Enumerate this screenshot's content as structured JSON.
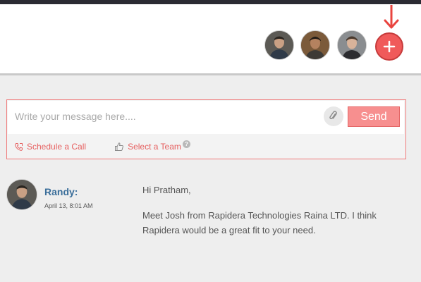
{
  "header": {
    "participants": [
      {
        "name": "participant-1",
        "icon": "avatar-photo"
      },
      {
        "name": "participant-2",
        "icon": "avatar-photo"
      },
      {
        "name": "participant-3",
        "icon": "avatar-photo"
      }
    ],
    "add_button_icon": "plus-icon",
    "indicator_icon": "down-arrow-icon",
    "accent_color": "#f05a5a"
  },
  "composer": {
    "placeholder": "Write your message here....",
    "value": "",
    "send_label": "Send",
    "attach_icon": "paperclip-icon",
    "actions": {
      "schedule_call": "Schedule a Call",
      "select_team": "Select a Team",
      "help_glyph": "?"
    }
  },
  "messages": [
    {
      "sender": "Randy:",
      "time": "April 13, 8:01 AM",
      "greeting": "Hi Pratham,",
      "text": "Meet Josh from Rapidera Technologies Raina LTD. I think Rapidera would be a great fit to your need."
    }
  ]
}
